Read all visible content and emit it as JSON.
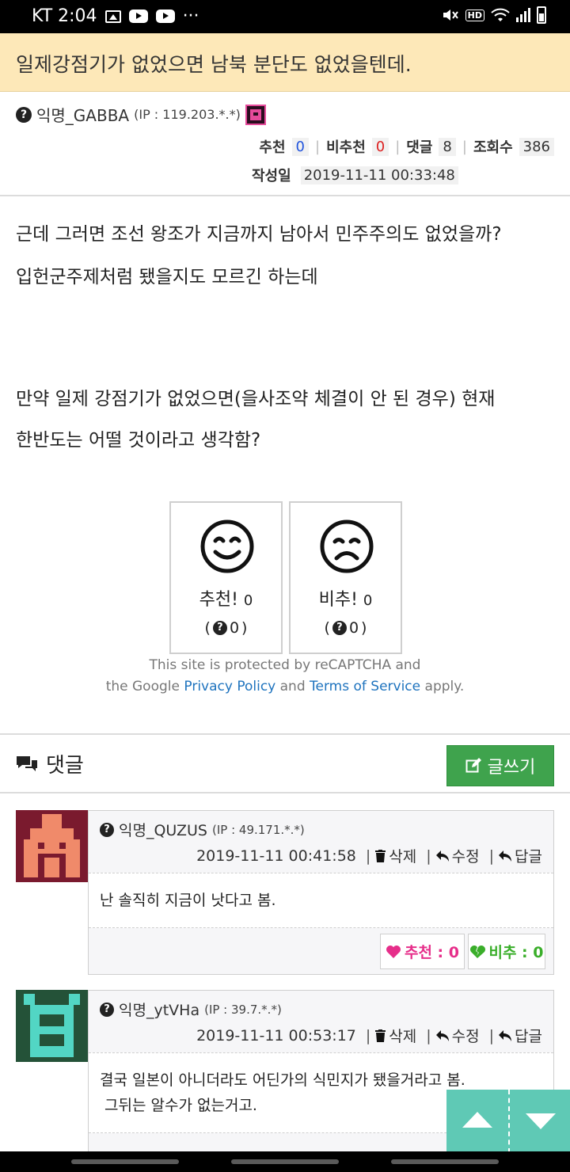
{
  "statusbar": {
    "carrier_time": "KT 2:04",
    "dots": "···",
    "hd": "HD"
  },
  "post": {
    "title": "일제강점기가 없었으면 남북 분단도 없었을텐데.",
    "author": "익명_GABBA",
    "ip": "(IP : 119.203.*.*)",
    "stats": {
      "recommend_label": "추천",
      "recommend": "0",
      "not_recommend_label": "비추천",
      "not_recommend": "0",
      "comments_label": "댓글",
      "comments": "8",
      "views_label": "조회수",
      "views": "386"
    },
    "date_label": "작성일",
    "date": "2019-11-11 00:33:48",
    "paragraphs": [
      "근데 그러면 조선 왕조가 지금까지 남아서 민주주의도 없었을까?",
      "입헌군주제처럼 됐을지도 모르긴 하는데",
      "만약 일제 강점기가 없었으면(을사조약 체결이 안 된 경우) 현재",
      "한반도는 어떨 것이라고 생각함?"
    ]
  },
  "votes": {
    "up_label": "추천!",
    "up_count": "0",
    "up_anon": "0",
    "down_label": "비추!",
    "down_count": "0",
    "down_anon": "0",
    "open_paren": "(",
    "close_paren": ")"
  },
  "recaptcha": {
    "line1": "This site is protected by reCAPTCHA and",
    "prefix": "the Google",
    "privacy": "Privacy Policy",
    "and": "and",
    "terms": "Terms of Service",
    "suffix": "apply."
  },
  "comments_section": {
    "title": "댓글",
    "write_label": "글쓰기"
  },
  "comments": [
    {
      "author": "익명_QUZUS",
      "ip": "(IP : 49.171.*.*)",
      "date": "2019-11-11 00:41:58",
      "delete": "삭제",
      "edit": "수정",
      "reply": "답글",
      "lines": [
        "난 솔직히 지금이 낫다고 봄."
      ],
      "up_label": "추천 : 0",
      "down_label": "비추 : 0",
      "avatar_bg": "#7a1a2e",
      "avatar_fg": "#f08a6a"
    },
    {
      "author": "익명_ytVHa",
      "ip": "(IP : 39.7.*.*)",
      "date": "2019-11-11 00:53:17",
      "delete": "삭제",
      "edit": "수정",
      "reply": "답글",
      "lines": [
        "결국 일본이 아니더라도 어딘가의 식민지가 됐을거라고 봄.",
        " 그뒤는 알수가 없는거고."
      ],
      "avatar_bg": "#245238",
      "avatar_fg": "#52d6c4"
    }
  ],
  "colors": {
    "title_bg": "#fde8b8",
    "accent_green": "#3fa34d",
    "link_blue": "#1e73be",
    "recommend_pink": "#e62e8a",
    "not_recommend_green": "#3aae2a",
    "scroll_teal": "#5fc9b5"
  },
  "icons": [
    "image-icon",
    "youtube-icon",
    "mute-icon",
    "wifi-icon",
    "signal-icon",
    "battery-icon",
    "question-icon",
    "speech-bubbles-icon",
    "edit-icon",
    "trash-icon",
    "reply-icon",
    "heart-icon",
    "broken-heart-icon",
    "smile-face-icon",
    "sad-face-icon",
    "arrow-up-icon",
    "arrow-down-icon"
  ]
}
